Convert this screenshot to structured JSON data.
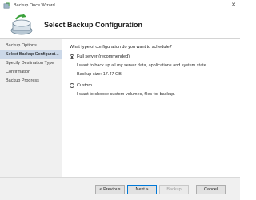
{
  "window": {
    "title": "Backup Once Wizard",
    "close_glyph": "✕"
  },
  "header": {
    "title": "Select Backup Configuration"
  },
  "sidebar": {
    "items": [
      {
        "label": "Backup Options"
      },
      {
        "label": "Select Backup Configurat..."
      },
      {
        "label": "Specify Destination Type"
      },
      {
        "label": "Confirmation"
      },
      {
        "label": "Backup Progress"
      }
    ]
  },
  "main": {
    "question": "What type of configuration do you want to schedule?",
    "options": [
      {
        "label": "Full server (recommended)",
        "description": "I want to back up all my server data, applications and system state.",
        "extra": "Backup size: 17.47 GB",
        "selected": true
      },
      {
        "label": "Custom",
        "description": "I want to choose custom volumes, files for backup.",
        "selected": false
      }
    ]
  },
  "footer": {
    "previous_label": "< Previous",
    "next_label": "Next >",
    "backup_label": "Backup",
    "cancel_label": "Cancel"
  },
  "colors": {
    "active_nav": "#ccd8e8",
    "default_button_border": "#0078d7"
  }
}
